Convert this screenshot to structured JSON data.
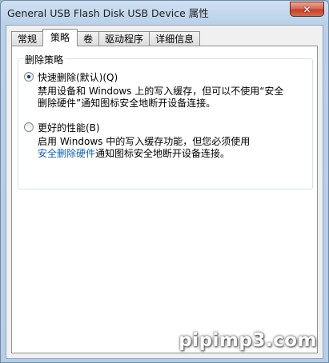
{
  "window": {
    "title": "General USB Flash Disk USB Device 属性",
    "close_glyph": "✕"
  },
  "tabs": [
    {
      "label": "常规",
      "active": false
    },
    {
      "label": "策略",
      "active": true
    },
    {
      "label": "卷",
      "active": false
    },
    {
      "label": "驱动程序",
      "active": false
    },
    {
      "label": "详细信息",
      "active": false
    }
  ],
  "group": {
    "title": "删除策略",
    "options": [
      {
        "label": "快速删除(默认)(Q)",
        "selected": true,
        "desc_line1": "禁用设备和 Windows 上的写入缓存，但可以不使用“安全",
        "desc_line2": "删除硬件”通知图标安全地断开设备连接。"
      },
      {
        "label": "更好的性能(B)",
        "selected": false,
        "desc_line1": "启用 Windows 中的写入缓存功能，但您必须使用",
        "desc_line2_link": "安全删除硬件",
        "desc_line2_rest": "通知图标安全地断开设备连接。"
      }
    ]
  },
  "watermark": "pipimp3.com",
  "colors": {
    "link": "#1460b8",
    "close_button": "#c2412b"
  }
}
